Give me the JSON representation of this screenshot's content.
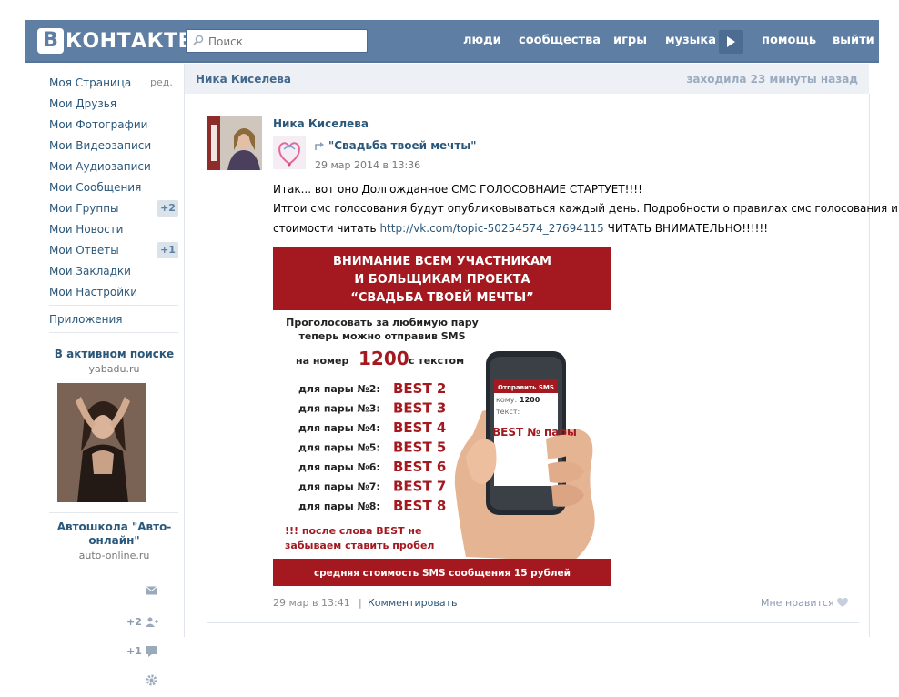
{
  "header": {
    "logo_letter": "В",
    "logo_text": "КОНТАКТЕ",
    "search_placeholder": "Поиск",
    "nav": [
      "люди",
      "сообщества",
      "игры",
      "музыка",
      "помощь",
      "выйти"
    ]
  },
  "sidebar": {
    "items": [
      {
        "label": "Моя Страница"
      },
      {
        "label": "Мои Друзья"
      },
      {
        "label": "Мои Фотографии"
      },
      {
        "label": "Мои Видеозаписи"
      },
      {
        "label": "Мои Аудиозаписи"
      },
      {
        "label": "Мои Сообщения"
      },
      {
        "label": "Мои Группы",
        "badge": "+2"
      },
      {
        "label": "Мои Новости"
      },
      {
        "label": "Мои Ответы",
        "badge": "+1"
      },
      {
        "label": "Мои Закладки"
      },
      {
        "label": "Мои Настройки"
      }
    ],
    "edit_label": "ред.",
    "apps_label": "Приложения",
    "ad1": {
      "title": "В активном поиске",
      "domain": "yabadu.ru"
    },
    "ad2": {
      "title_line1": "Автошкола \"Авто-",
      "title_line2": "онлайн\"",
      "domain": "auto-online.ru"
    },
    "quick": {
      "friends_count": "+2",
      "comments_count": "+1"
    }
  },
  "page": {
    "owner_name": "Ника Киселева",
    "last_seen": "заходила 23 минуты назад"
  },
  "post": {
    "author": "Ника Киселева",
    "group_name": "\"Свадьба твоей мечты\"",
    "group_date": "29 мар 2014 в 13:36",
    "line1": "Итак... вот оно Долгожданное СМС ГОЛОСОВНАИЕ СТАРТУЕТ!!!!",
    "line2": "Итгои смс голосования будут опубликовываться каждый день. Подробности о правилах смс голосования и",
    "line3_prefix": "стоимости читать ",
    "line3_link": "http://vk.com/topic-50254574_27694115",
    "line3_suffix": " ЧИТАТЬ ВНИМАТЕЛЬНО!!!!!!",
    "footer_date": "29 мар в 13:41",
    "footer_sep": "|",
    "comment_label": "Комментировать",
    "like_label": "Мне нравится"
  },
  "banner": {
    "head1": "ВНИМАНИЕ ВСЕМ УЧАСТНИКАМ",
    "head2": "И БОЛЬЩИКАМ ПРОЕКТА",
    "head3": "“СВАДЬБА ТВОЕЙ МЕЧТЫ”",
    "intro1": "Проголосовать за любимую пару",
    "intro2": "теперь можно отправив SMS",
    "number_prefix": "на номер",
    "number": "1200",
    "number_suffix": "с текстом",
    "pairs": [
      {
        "label": "для пары №2:",
        "code": "BEST 2"
      },
      {
        "label": "для пары №3:",
        "code": "BEST 3"
      },
      {
        "label": "для пары №4:",
        "code": "BEST 4"
      },
      {
        "label": "для пары №5:",
        "code": "BEST 5"
      },
      {
        "label": "для пары №6:",
        "code": "BEST 6"
      },
      {
        "label": "для пары №7:",
        "code": "BEST 7"
      },
      {
        "label": "для пары №8:",
        "code": "BEST 8"
      }
    ],
    "note1": "!!! после слова BEST не",
    "note2": "забываем ставить пробел",
    "footer": "средняя стоимость SMS сообщения 15 рублей",
    "phone": {
      "send_label": "Отправить SMS",
      "to_label": "кому:",
      "to_value": "1200",
      "text_label": "текст:",
      "text_value": "BEST № пары"
    }
  },
  "colors": {
    "header_bg": "#5f7ea3",
    "link": "#2b587a",
    "banner_red": "#a3191f"
  }
}
